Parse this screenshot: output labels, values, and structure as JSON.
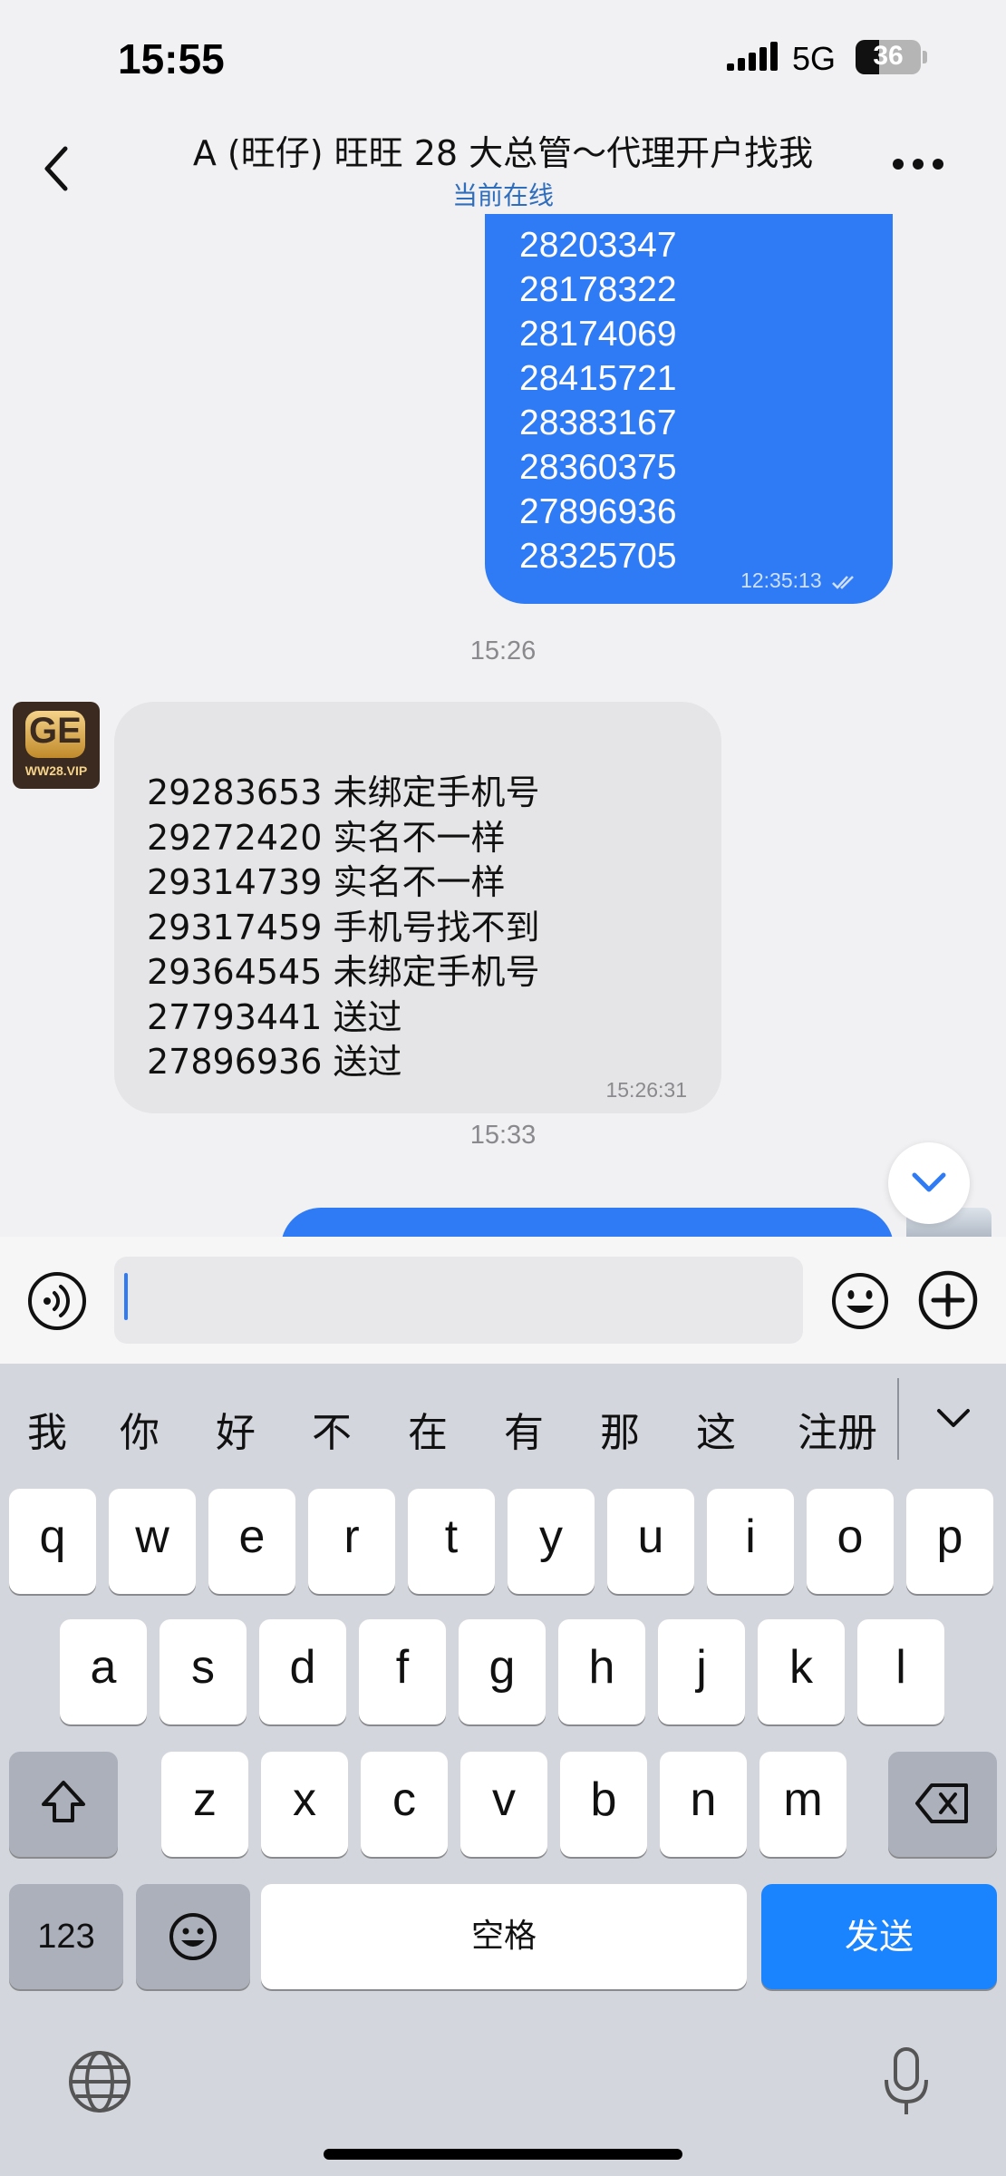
{
  "status_bar": {
    "time": "15:55",
    "network": "5G",
    "battery_level": "36",
    "battery_fraction": 0.36
  },
  "header": {
    "title": "A (旺仔) 旺旺 28 大总管～代理开户找我",
    "subtitle": "当前在线"
  },
  "messages": {
    "outgoing_numbers": [
      "28203347",
      "28178322",
      "28174069",
      "28415721",
      "28383167",
      "28360375",
      "27896936",
      "28325705"
    ],
    "outgoing_time": "12:35:13",
    "date_chip_1": "15:26",
    "incoming_avatar_text": "WW28.VIP",
    "incoming_avatar_logo": "GE",
    "incoming_lines": [
      "29283653 未绑定手机号",
      "29272420 实名不一样",
      "29314739 实名不一样",
      "29317459 手机号找不到",
      "29364545 未绑定手机号",
      "27793441 送过",
      "27896936 送过"
    ],
    "incoming_time": "15:26:31",
    "date_chip_2": "15:33"
  },
  "input": {
    "value": "",
    "placeholder": ""
  },
  "keyboard": {
    "candidates": [
      "我",
      "你",
      "好",
      "不",
      "在",
      "有",
      "那",
      "这",
      "注册"
    ],
    "row1": [
      "q",
      "w",
      "e",
      "r",
      "t",
      "y",
      "u",
      "i",
      "o",
      "p"
    ],
    "row2": [
      "a",
      "s",
      "d",
      "f",
      "g",
      "h",
      "j",
      "k",
      "l"
    ],
    "row3": [
      "z",
      "x",
      "c",
      "v",
      "b",
      "n",
      "m"
    ],
    "num_key": "123",
    "space_label": "空格",
    "send_label": "发送"
  },
  "colors": {
    "accent_blue": "#2f7bf6",
    "send_blue": "#1a84ff",
    "online_blue": "#2f6dbd"
  },
  "icons": {
    "back": "chevron-left-icon",
    "more": "more-dots-icon",
    "voice": "voice-icon",
    "emoji": "emoji-icon",
    "plus": "plus-icon",
    "scroll_down": "chevron-down-icon",
    "shift": "shift-icon",
    "delete": "backspace-icon",
    "globe": "globe-icon",
    "mic": "mic-icon"
  }
}
